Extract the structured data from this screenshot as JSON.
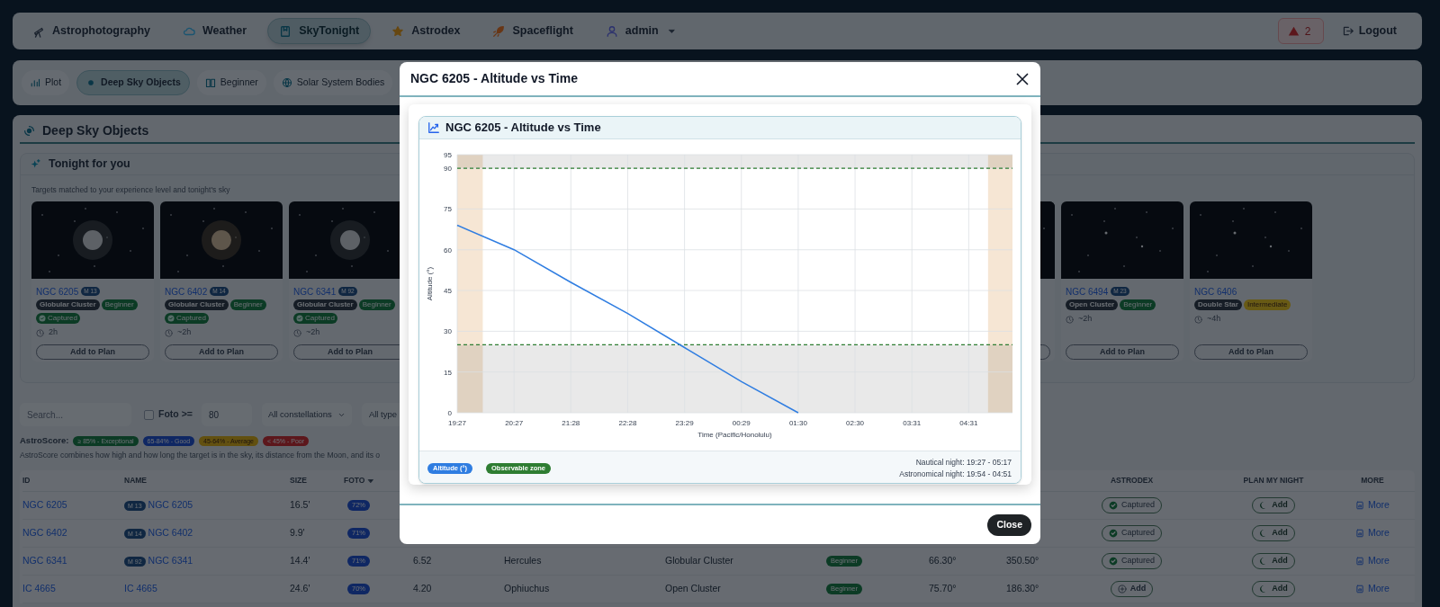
{
  "nav": {
    "items": [
      {
        "label": "Astrophotography",
        "selected": false
      },
      {
        "label": "Weather",
        "selected": false
      },
      {
        "label": "SkyTonight",
        "selected": true
      },
      {
        "label": "Astrodex",
        "selected": false
      },
      {
        "label": "Spaceflight",
        "selected": false
      },
      {
        "label": "admin",
        "selected": false,
        "menu": true
      }
    ],
    "alerts": "2",
    "logout": "Logout"
  },
  "subnav": {
    "tabs": [
      {
        "label": "Plot",
        "selected": false
      },
      {
        "label": "Deep Sky Objects",
        "selected": true
      },
      {
        "label": "Beginner",
        "selected": false
      },
      {
        "label": "Solar System Bodies",
        "selected": false
      }
    ]
  },
  "section": {
    "title": "Deep Sky Objects",
    "tonight": {
      "title": "Tonight for you",
      "subtitle": "Targets matched to your experience level and tonight's sky",
      "cards": [
        {
          "name": "NGC 6205",
          "messier": "M 13",
          "tags": [
            {
              "label": "Globular Cluster",
              "kind": "type"
            },
            {
              "label": "Beginner",
              "kind": "beginner"
            }
          ],
          "captured": true,
          "captured_label": "Captured",
          "duration": "2h",
          "button": "Add to Plan"
        },
        {
          "name": "NGC 6402",
          "messier": "M 14",
          "tags": [
            {
              "label": "Globular Cluster",
              "kind": "type"
            },
            {
              "label": "Beginner",
              "kind": "beginner"
            }
          ],
          "captured": true,
          "captured_label": "Captured",
          "duration": "~2h",
          "button": "Add to Plan"
        },
        {
          "name": "NGC 6341",
          "messier": "M 92",
          "tags": [
            {
              "label": "Globular Cluster",
              "kind": "type"
            },
            {
              "label": "Beginner",
              "kind": "beginner"
            }
          ],
          "captured": true,
          "captured_label": "Captured",
          "duration": "~2h",
          "button": "Add to Plan"
        },
        {
          "name": "NGC 6494",
          "messier": "M 23",
          "tags": [
            {
              "label": "Open Cluster",
              "kind": "type"
            },
            {
              "label": "Beginner",
              "kind": "beginner"
            }
          ],
          "captured": false,
          "duration": "~2h",
          "button": "Add to Plan"
        },
        {
          "name": "NGC 6406",
          "tags": [
            {
              "label": "Double Star",
              "kind": "type"
            },
            {
              "label": "Intermediate",
              "kind": "intermediate"
            }
          ],
          "captured": false,
          "duration": "~4h",
          "button": "Add to Plan"
        }
      ]
    },
    "filters": {
      "search_placeholder": "Search...",
      "foto_checked": false,
      "foto_label": "Foto >=",
      "foto_value": "80",
      "constellation": "All constellations",
      "type": "All type"
    },
    "astroscore": {
      "label": "AstroScore:",
      "legend": [
        {
          "label": "≥ 85% - Exceptional",
          "kind": "exceptional"
        },
        {
          "label": "65-84% - Good",
          "kind": "good"
        },
        {
          "label": "45-64% - Average",
          "kind": "average"
        },
        {
          "label": "< 45% - Poor",
          "kind": "poor"
        }
      ],
      "note": "AstroScore combines how high and how long the target is in the sky, its distance from the Moon, and its o"
    },
    "table": {
      "columns": [
        {
          "label": "ID",
          "kind": "link"
        },
        {
          "label": "NAME",
          "kind": "name"
        },
        {
          "label": "SIZE",
          "kind": "text"
        },
        {
          "label": "FOTO",
          "kind": "score",
          "sorted": true
        },
        {
          "kind": "text"
        },
        {
          "kind": "text"
        },
        {
          "kind": "text"
        },
        {
          "kind": "level"
        },
        {
          "kind": "text"
        },
        {
          "kind": "text"
        },
        {
          "label": "ASTRODEX",
          "kind": "astrodex"
        },
        {
          "label": "PLAN MY NIGHT",
          "kind": "plan"
        },
        {
          "label": "MORE",
          "kind": "more"
        }
      ],
      "rows": [
        {
          "cells": [
            "NGC 6205",
            {
              "messier": "M 13",
              "text": "NGC 6205"
            },
            "16.5'",
            "72%",
            null,
            null,
            null,
            null,
            null,
            null,
            {
              "label": "Captured",
              "captured": true
            },
            "Add",
            "More"
          ]
        },
        {
          "cells": [
            "NGC 6402",
            {
              "messier": "M 14",
              "text": "NGC 6402"
            },
            "9.9'",
            "71%",
            null,
            null,
            null,
            null,
            null,
            null,
            {
              "label": "Captured",
              "captured": true
            },
            "Add",
            "More"
          ]
        },
        {
          "cells": [
            "NGC 6341",
            {
              "messier": "M 92",
              "text": "NGC 6341"
            },
            "14.4'",
            "71%",
            "6.52",
            "Hercules",
            "Globular Cluster",
            "Beginner",
            "66.30°",
            "350.50°",
            {
              "label": "Captured",
              "captured": true
            },
            "Add",
            "More"
          ]
        },
        {
          "cells": [
            "IC 4665",
            {
              "text": "IC 4665"
            },
            "24.6'",
            "70%",
            "4.20",
            "Ophiuchus",
            "Open Cluster",
            "Beginner",
            "75.70°",
            "186.30°",
            {
              "label": "Add",
              "captured": false
            },
            "Add",
            "More"
          ]
        }
      ]
    }
  },
  "modal": {
    "title": "NGC 6205 - Altitude vs Time",
    "close_button": "Close",
    "chart_card": {
      "title": "NGC 6205 - Altitude vs Time",
      "chart_data": {
        "type": "line",
        "xlabel": "Time (Pacific/Honolulu)",
        "ylabel": "Altitude (°)",
        "categories": [
          "19:27",
          "20:27",
          "21:28",
          "22:28",
          "23:29",
          "00:29",
          "01:30",
          "02:30",
          "03:31",
          "04:31"
        ],
        "series": [
          {
            "name": "Altitude (°)",
            "color": "#2f7de1",
            "values": [
              69,
              60,
              48,
              36.5,
              24,
              11.5,
              0,
              null,
              null,
              null
            ]
          }
        ],
        "ylim": [
          0,
          95
        ],
        "yticks": [
          0,
          15,
          30,
          45,
          60,
          75,
          90,
          95
        ],
        "grid": true,
        "bands": [
          {
            "axis": "y",
            "from": 0,
            "to": 25
          },
          {
            "axis": "y",
            "from": 90,
            "to": 95
          }
        ],
        "ref_lines": [
          {
            "axis": "y",
            "value": 25
          },
          {
            "axis": "y",
            "value": 90
          }
        ]
      },
      "legend": [
        {
          "label": "Observable zone",
          "color": "#2e7d32"
        }
      ],
      "notes": [
        "Nautical night: 19:27 - 05:17",
        "Astronomical night: 19:54 - 04:51"
      ]
    }
  }
}
